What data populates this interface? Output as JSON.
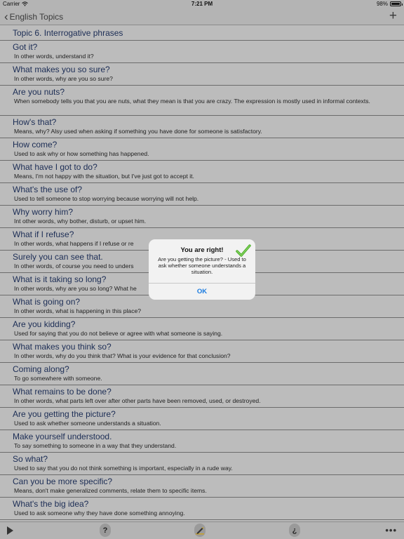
{
  "status_bar": {
    "carrier": "Carrier",
    "time": "7:21 PM",
    "battery": "98%"
  },
  "nav": {
    "back_label": "English Topics",
    "add_icon": "plus-icon"
  },
  "list": {
    "header": "Topic 6. Interrogative phrases",
    "items": [
      {
        "title": "Got it?",
        "desc": "In other words, understand it?"
      },
      {
        "title": "What makes you so sure?",
        "desc": "In other words, why are you so sure?"
      },
      {
        "title": "Are you nuts?",
        "desc": "When somebody tells you that you are nuts, what they mean is that you are crazy. The expression is mostly used in informal contexts."
      },
      {
        "title": "How's that?",
        "desc": "Means, why? Alsy used when asking if something you have done for someone is satisfactory."
      },
      {
        "title": "How come?",
        "desc": "Used to ask why or how something has happened."
      },
      {
        "title": "What have I got to do?",
        "desc": "Means, I'm not happy with the situation, but I've just got to accept it."
      },
      {
        "title": "What's the use of?",
        "desc": "Used to tell someone to stop worrying because worrying will not help."
      },
      {
        "title": "Why worry him?",
        "desc": "Int other words, why bother, disturb, or upset him."
      },
      {
        "title": "What if I refuse?",
        "desc": "In other words, what happens if I refuse or re"
      },
      {
        "title": "Surely you can see that.",
        "desc": "In other words, of course you need to unders"
      },
      {
        "title": "What is it taking so long?",
        "desc": "In other words, why are you so long? What he"
      },
      {
        "title": "What is going on?",
        "desc": "In other words, what is happening in this place?"
      },
      {
        "title": "Are you kidding?",
        "desc": "Used for saying that you do not believe or agree with what someone is saying."
      },
      {
        "title": "What makes you think so?",
        "desc": "In other words, why do you think that? What is your evidence for that conclusion?"
      },
      {
        "title": "Coming along?",
        "desc": "To go somewhere with someone."
      },
      {
        "title": "What remains to be done?",
        "desc": "In other words, what parts left over after other parts have been removed, used, or destroyed."
      },
      {
        "title": "Are you getting the picture?",
        "desc": "Used to ask whether someone understands a situation."
      },
      {
        "title": "Make yourself understood.",
        "desc": "To say something to someone in a way that they understand."
      },
      {
        "title": "So what?",
        "desc": "Used to say that you do not think something is important, especially in a rude way."
      },
      {
        "title": "Can you be more specific?",
        "desc": "Means, don't make generalized comments, relate them to specific items."
      },
      {
        "title": "What's the big idea?",
        "desc": "Used to ask someone why they have done something annoying."
      }
    ]
  },
  "alert": {
    "title": "You are right!",
    "message": "Are you getting the picture?  -  Used to ask whether someone understands a situation.",
    "ok_label": "OK",
    "icon": "checkmark-icon"
  },
  "toolbar": {
    "play_icon": "play-icon",
    "help_label": "?",
    "edit_icon": "pencil-icon",
    "question_label": "¿",
    "more_label": "•••"
  },
  "colors": {
    "accent": "#1a7be0",
    "title_text": "#1c2d55",
    "check": "#4caf2a"
  }
}
